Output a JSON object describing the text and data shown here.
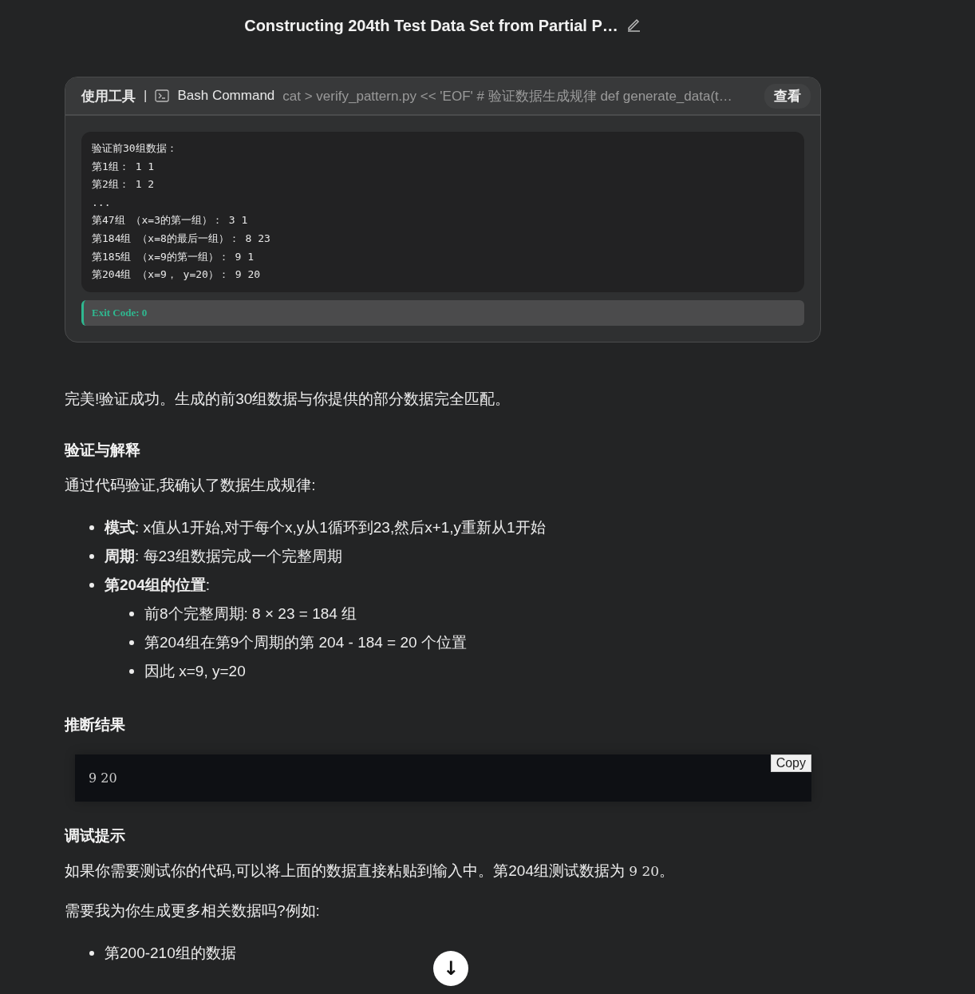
{
  "header": {
    "title": "Constructing 204th Test Data Set from Partial P…"
  },
  "tool_call": {
    "label": "使用工具",
    "separator": "|",
    "tool": "Bash Command",
    "command": "cat > verify_pattern.py << 'EOF' # 验证数据生成规律 def generate_data(t…",
    "view_button": "查看",
    "output": [
      "验证前30组数据：",
      "第1组： 1 1",
      "第2组： 1 2",
      "...",
      "第47组 （x=3的第一组）： 3 1",
      "第184组 （x=8的最后一组）： 8 23",
      "第185组 （x=9的第一组）： 9 1",
      "第204组 （x=9， y=20）： 9 20"
    ],
    "exit_code": "Exit Code: 0"
  },
  "blocks": [
    {
      "kind": "paragraph",
      "text": "完美!验证成功。生成的前30组数据与你提供的部分数据完全匹配。"
    },
    {
      "kind": "heading",
      "text": "验证与解释"
    },
    {
      "kind": "paragraph",
      "text": "通过代码验证,我确认了数据生成规律:"
    },
    {
      "kind": "list",
      "items": [
        {
          "text": "**模式**: x值从1开始,对于每个x,y从1循环到23,然后x+1,y重新从1开始"
        },
        {
          "text": "**周期**: 每23组数据完成一个完整周期"
        },
        {
          "text": "**第204组的位置**:",
          "children": [
            {
              "text": "前8个完整周期: 8 × 23 = 184 组"
            },
            {
              "text": "第204组在第9个周期的第 204 - 184 = 20 个位置"
            },
            {
              "text": "因此 x=9, y=20"
            }
          ]
        }
      ]
    },
    {
      "kind": "heading",
      "text": "推断结果"
    },
    {
      "kind": "code",
      "text": "9 20",
      "copy": "Copy"
    },
    {
      "kind": "heading",
      "text": "调试提示"
    },
    {
      "kind": "paragraph",
      "parts": [
        {
          "kind": "text",
          "text": "如果你需要测试你的代码,可以将上面的数据直接粘贴到输入中。第204组测试数据为 "
        },
        {
          "kind": "code",
          "text": "9 20"
        },
        {
          "kind": "text",
          "text": "。"
        }
      ]
    },
    {
      "kind": "paragraph",
      "text": "需要我为你生成更多相关数据吗?例如:"
    },
    {
      "kind": "list",
      "items": [
        {
          "text": "第200-210组的数据"
        }
      ]
    }
  ],
  "scroll_button": {
    "icon": "↓"
  }
}
